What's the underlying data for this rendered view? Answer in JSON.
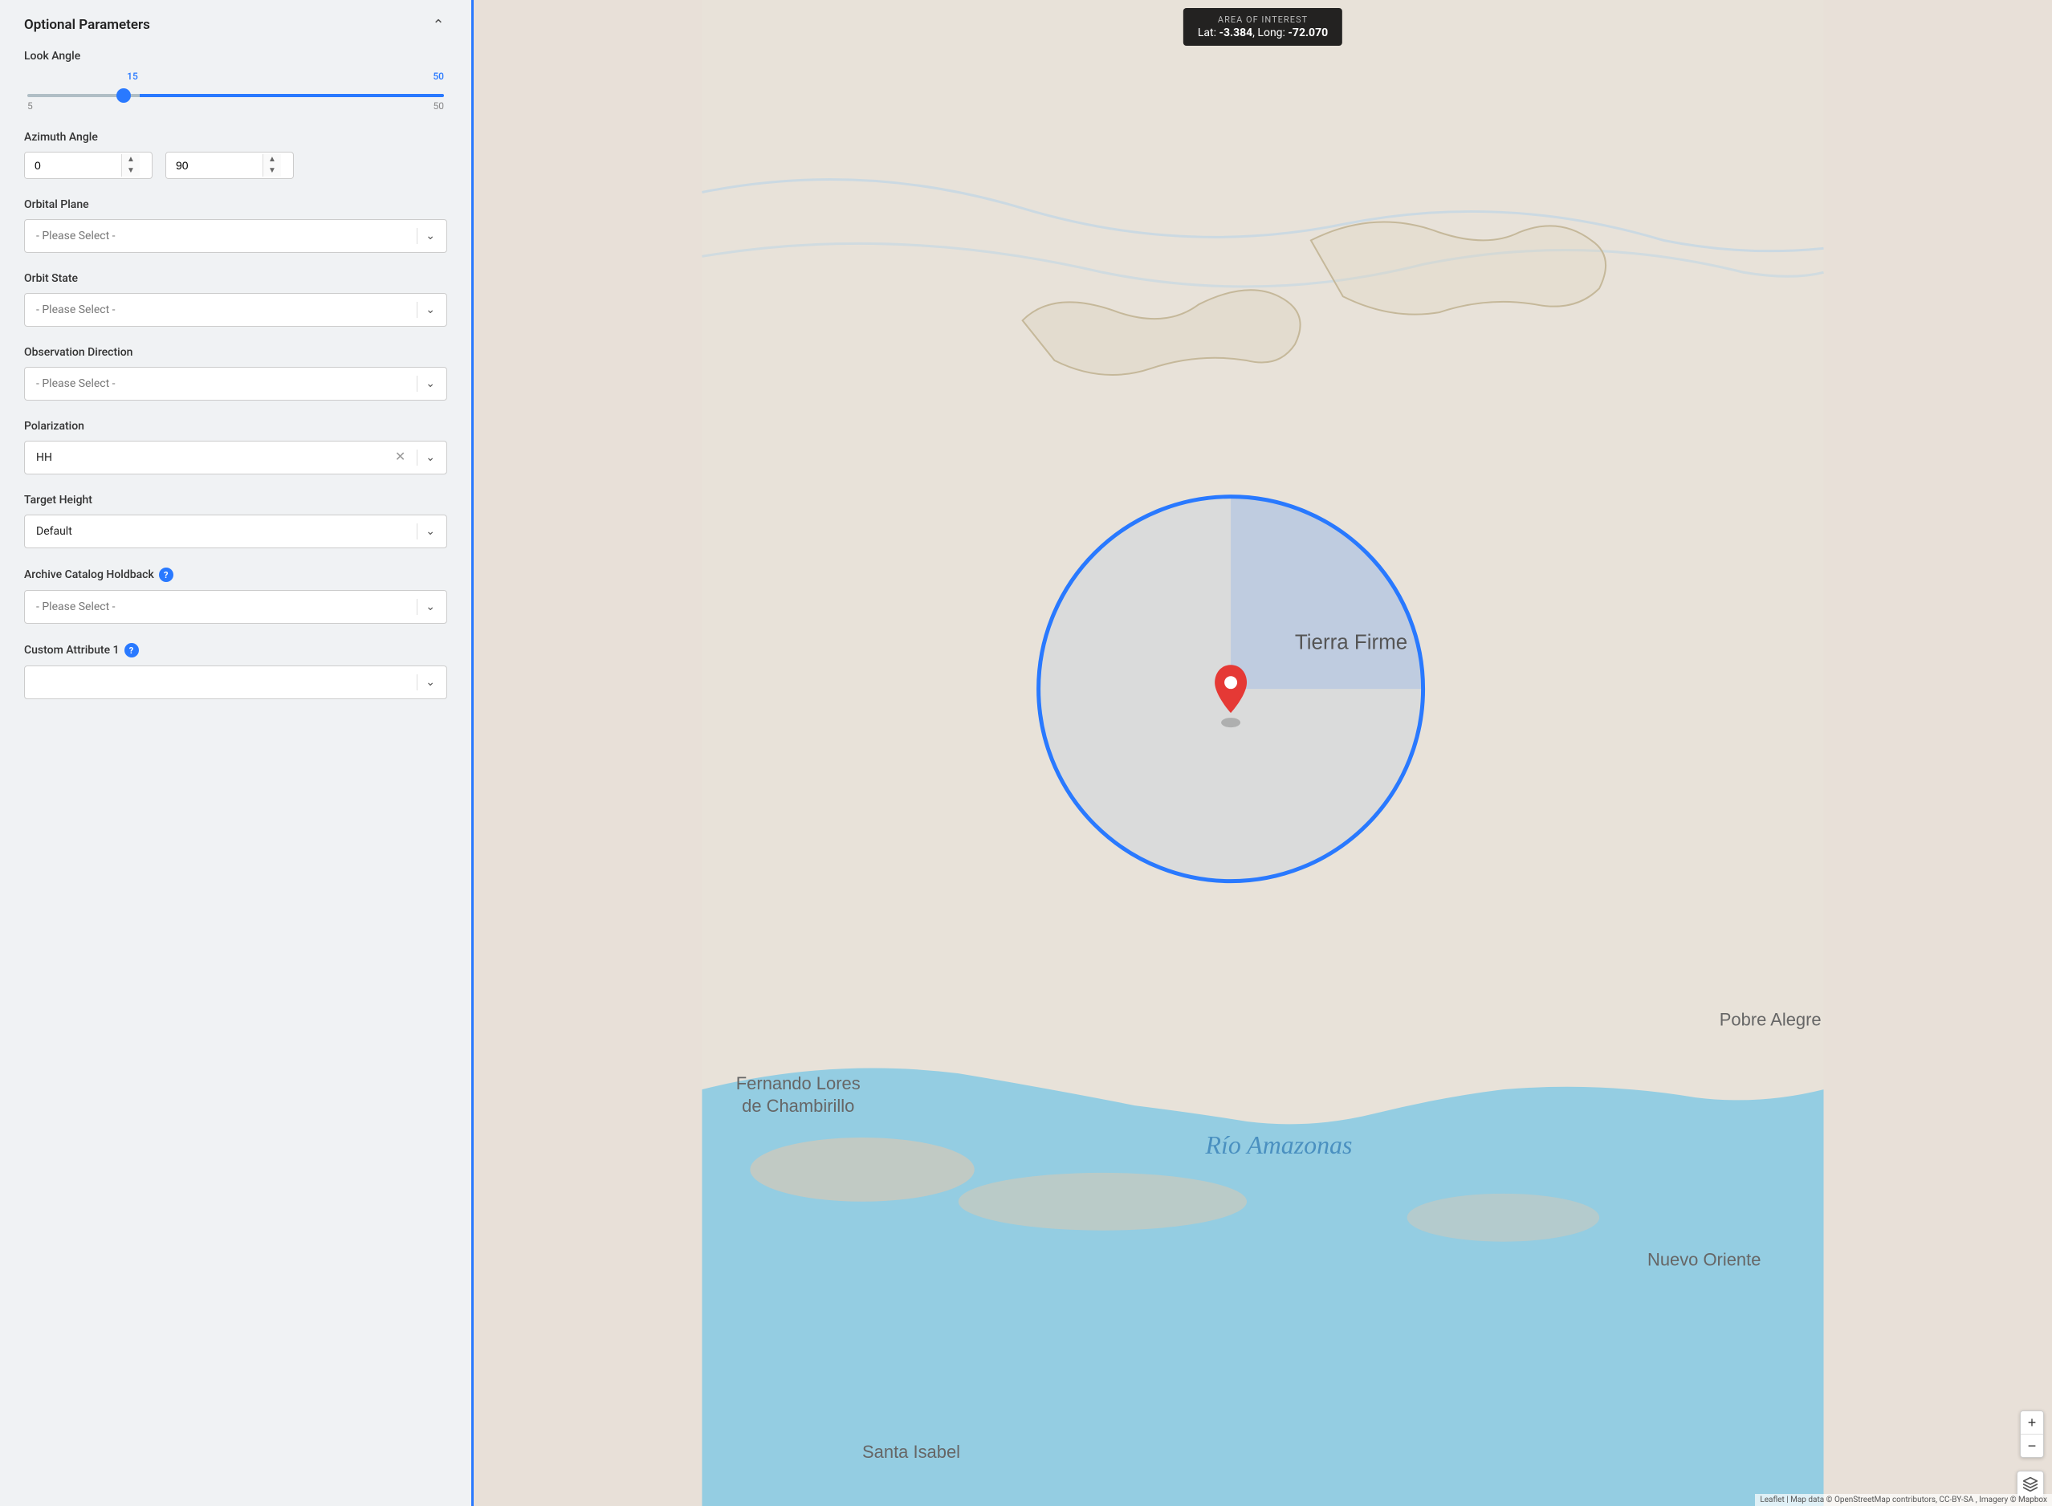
{
  "panel": {
    "title": "Optional Parameters",
    "look_angle": {
      "label": "Look Angle",
      "min": 5,
      "max": 50,
      "left_value": 15,
      "right_value": 50
    },
    "azimuth_angle": {
      "label": "Azimuth Angle",
      "left_value": "0",
      "right_value": "90"
    },
    "orbital_plane": {
      "label": "Orbital Plane",
      "placeholder": "- Please Select -"
    },
    "orbit_state": {
      "label": "Orbit State",
      "placeholder": "- Please Select -"
    },
    "observation_direction": {
      "label": "Observation Direction",
      "placeholder": "- Please Select -"
    },
    "polarization": {
      "label": "Polarization",
      "value": "HH"
    },
    "target_height": {
      "label": "Target Height",
      "value": "Default"
    },
    "archive_catalog_holdback": {
      "label": "Archive Catalog Holdback",
      "placeholder": "- Please Select -",
      "has_help": true
    },
    "custom_attribute_1": {
      "label": "Custom Attribute 1",
      "has_help": true
    }
  },
  "map": {
    "tooltip": {
      "label": "AREA OF INTEREST",
      "lat_label": "Lat:",
      "lat_value": "-3.384",
      "lon_label": "Long:",
      "lon_value": "-72.070"
    },
    "attribution": "Leaflet | Map data © OpenStreetMap contributors, CC-BY-SA , Imagery © Mapbox",
    "place_names": [
      "Tierra Firme",
      "Fernando Lores de Chambirillo",
      "Pobre Alegre",
      "Nuevo Oriente",
      "Río Amazonas",
      "Santa Isabel"
    ],
    "zoom_in_label": "+",
    "zoom_out_label": "−"
  }
}
